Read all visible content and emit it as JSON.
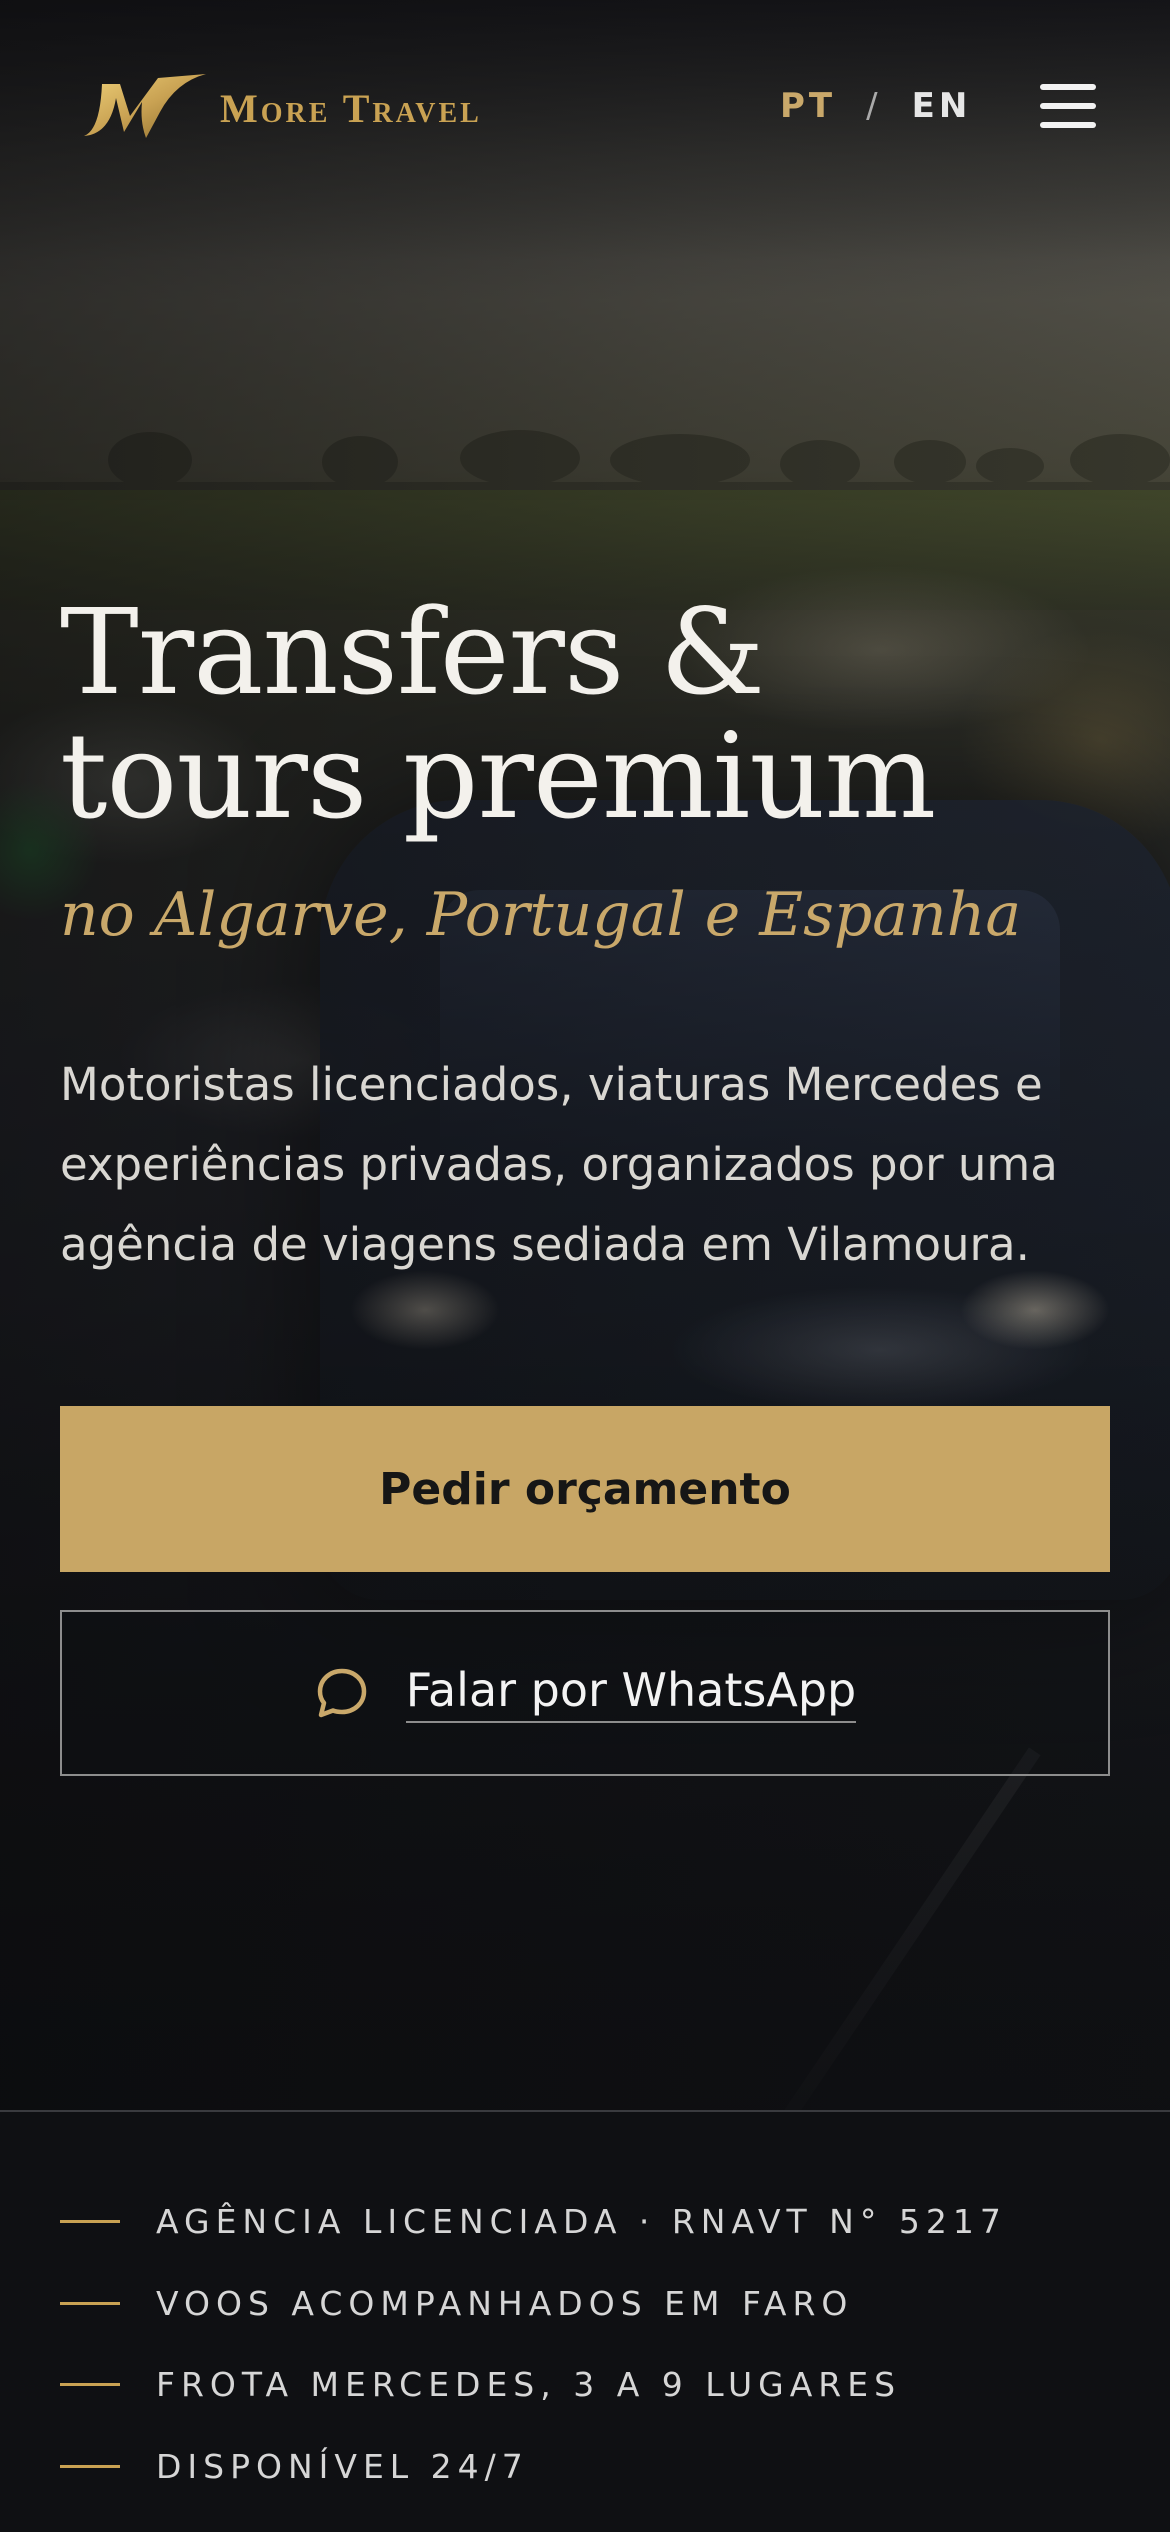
{
  "brand": {
    "name": "More Travel",
    "logo_icon": "mt-monogram-logo",
    "accent": "#c9a86a"
  },
  "header": {
    "lang_pt": "PT",
    "lang_separator": "/",
    "lang_en": "EN",
    "menu_icon": "hamburger-menu-icon"
  },
  "hero": {
    "title_line1": "Transfers &",
    "title_line2": "tours premium",
    "subtitle": "no Algarve, Portugal e Espanha",
    "intro": "Motoristas licenciados, viaturas Mercedes e experiências privadas, organizados por uma agência de viagens sediada em Vilamoura."
  },
  "cta": {
    "primary_label": "Pedir orçamento",
    "primary_color": "#c8a665",
    "secondary_label": "Falar por WhatsApp",
    "secondary_icon": "chat-bubble-icon"
  },
  "trust": {
    "items": [
      {
        "label": "AGÊNCIA LICENCIADA · RNAVT N° 5217"
      },
      {
        "label": "VOOS ACOMPANHADOS EM FARO"
      },
      {
        "label": "FROTA MERCEDES, 3 A 9 LUGARES"
      },
      {
        "label": "DISPONÍVEL 24/7"
      }
    ]
  }
}
